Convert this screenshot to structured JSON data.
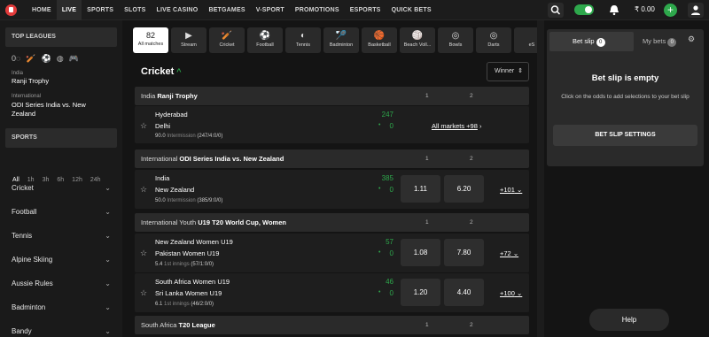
{
  "nav": {
    "items": [
      "HOME",
      "LIVE",
      "SPORTS",
      "SLOTS",
      "LIVE CASINO",
      "BETGAMES",
      "V-SPORT",
      "PROMOTIONS",
      "ESPORTS",
      "QUICK BETS"
    ],
    "active": "LIVE",
    "balance": "₹ 0.00",
    "deposit": "+"
  },
  "sidebar": {
    "top_leagues_title": "TOP LEAGUES",
    "live_count": "0",
    "leagues": [
      {
        "group": "India",
        "title": "Ranji Trophy"
      },
      {
        "group": "International",
        "title": "ODI Series India vs. New Zealand"
      }
    ],
    "sports_title": "SPORTS",
    "time_filters": [
      "All",
      "1h",
      "3h",
      "6h",
      "12h",
      "24h"
    ],
    "sports": [
      "Cricket",
      "Football",
      "Tennis",
      "Alpine Skiing",
      "Aussie Rules",
      "Badminton",
      "Bandy"
    ]
  },
  "categories": [
    {
      "icon": "",
      "label": "All matches",
      "count": "82"
    },
    {
      "icon": "▶",
      "label": "Stream"
    },
    {
      "icon": "🏏",
      "label": "Cricket"
    },
    {
      "icon": "⚽",
      "label": "Football"
    },
    {
      "icon": "◐",
      "label": "Tennis"
    },
    {
      "icon": "🏸",
      "label": "Badminton"
    },
    {
      "icon": "🏀",
      "label": "Basketball"
    },
    {
      "icon": "🏐",
      "label": "Beach Voll..."
    },
    {
      "icon": "◎",
      "label": "Bowls"
    },
    {
      "icon": "◎",
      "label": "Darts"
    },
    {
      "icon": "",
      "label": "eS"
    }
  ],
  "main": {
    "title": "Cricket",
    "title_caret": "^",
    "market_select": "Winner",
    "col1": "1",
    "col2": "2"
  },
  "leagues": [
    {
      "country": "India",
      "name": "Ranji Trophy",
      "events": [
        {
          "team1": "Hyderabad",
          "team2": "Delhi",
          "score1": "247",
          "score2": "0",
          "over": "90.0",
          "status": "Intermission",
          "detail": "(247/4:0/0)",
          "all_markets": "All markets +98"
        }
      ]
    },
    {
      "country": "International",
      "name": "ODI Series India vs. New Zealand",
      "events": [
        {
          "team1": "India",
          "team2": "New Zealand",
          "score1": "385",
          "score2": "0",
          "over": "50.0",
          "status": "Intermission",
          "detail": "(385/9:0/0)",
          "odd1": "1.11",
          "odd2": "6.20",
          "more": "+101"
        }
      ]
    },
    {
      "country": "International Youth",
      "name": "U19 T20 World Cup, Women",
      "events": [
        {
          "team1": "New Zealand Women U19",
          "team2": "Pakistan Women U19",
          "score1": "57",
          "score2": "0",
          "over": "5.4",
          "status": "1st innings",
          "detail": "(57/1:0/0)",
          "odd1": "1.08",
          "odd2": "7.80",
          "more": "+72"
        },
        {
          "team1": "South Africa Women U19",
          "team2": "Sri Lanka Women U19",
          "score1": "46",
          "score2": "0",
          "over": "6.1",
          "status": "1st innings",
          "detail": "(46/2:0/0)",
          "odd1": "1.20",
          "odd2": "4.40",
          "more": "+100"
        }
      ]
    },
    {
      "country": "South Africa",
      "name": "T20 League",
      "events": []
    }
  ],
  "betslip": {
    "tab1": "Bet slip",
    "tab1_count": "0",
    "tab2": "My bets",
    "tab2_count": "0",
    "empty_title": "Bet slip is empty",
    "empty_desc": "Click on the odds to add selections to your bet slip",
    "settings_button": "BET SLIP SETTINGS"
  },
  "help": "Help"
}
